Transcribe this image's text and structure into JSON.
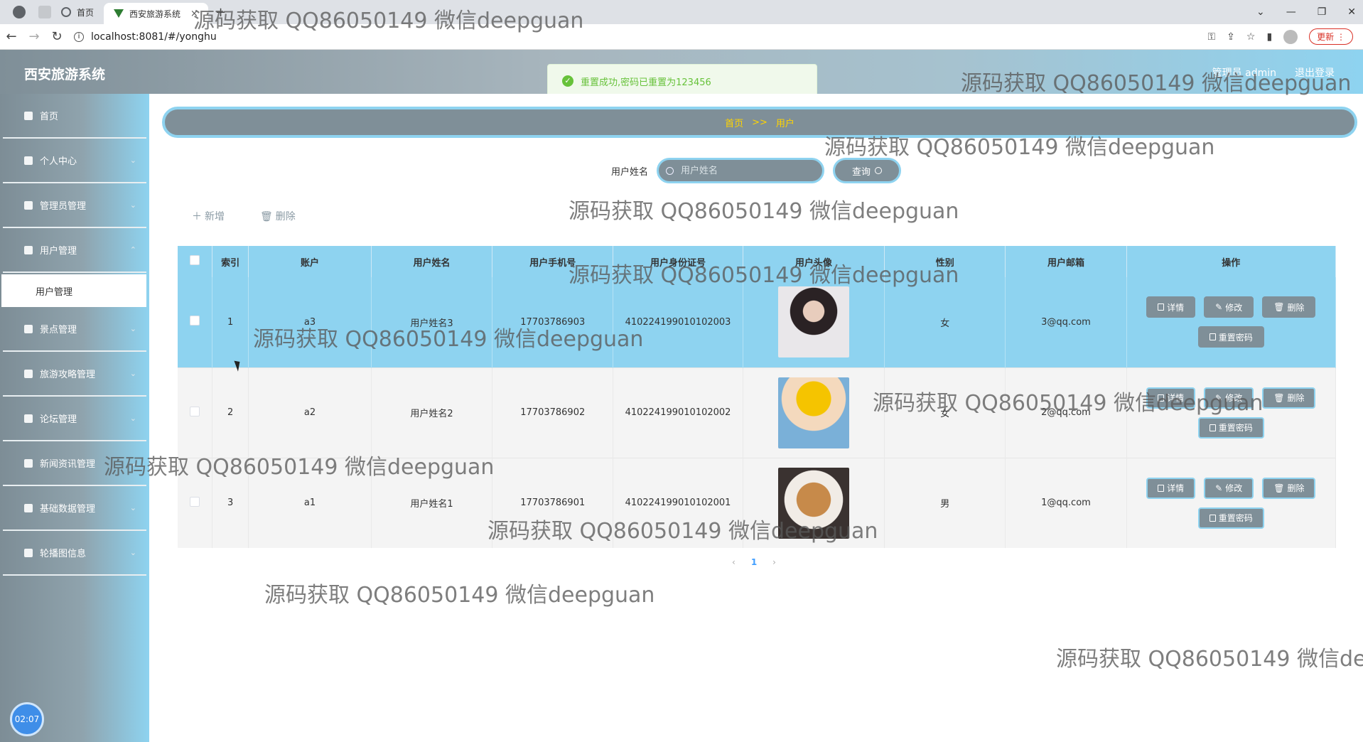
{
  "browser": {
    "tabs": [
      {
        "label": "首页",
        "icon": "globe-icon"
      },
      {
        "label": "西安旅游系统",
        "icon": "vue-logo-icon"
      }
    ],
    "url": "localhost:8081/#/yonghu",
    "update_label": "更新",
    "new_tab": "+",
    "close_tab": "×"
  },
  "app": {
    "title": "西安旅游系统",
    "user_label": "管理员 admin",
    "logout_label": "退出登录"
  },
  "toast": {
    "message": "重置成功,密码已重置为123456",
    "color": "#67c23a"
  },
  "sidebar": {
    "items": [
      {
        "label": "首页",
        "icon": "home-icon",
        "has_arrow": false
      },
      {
        "label": "个人中心",
        "icon": "user-icon",
        "has_arrow": true
      },
      {
        "label": "管理员管理",
        "icon": "grid-icon",
        "has_arrow": true
      },
      {
        "label": "用户管理",
        "icon": "grid-icon",
        "has_arrow": true
      },
      {
        "label": "景点管理",
        "icon": "chat-icon",
        "has_arrow": true
      },
      {
        "label": "旅游攻略管理",
        "icon": "doc-icon",
        "has_arrow": true
      },
      {
        "label": "论坛管理",
        "icon": "user-icon",
        "has_arrow": true
      },
      {
        "label": "新闻资讯管理",
        "icon": "grid-icon",
        "has_arrow": true
      },
      {
        "label": "基础数据管理",
        "icon": "printer-icon",
        "has_arrow": true
      },
      {
        "label": "轮播图信息",
        "icon": "menu-icon",
        "has_arrow": true
      }
    ],
    "submenu_active": "用户管理",
    "clock": "02:07"
  },
  "breadcrumb": {
    "home": "首页",
    "sep": ">>",
    "current": "用户"
  },
  "search": {
    "label": "用户姓名",
    "placeholder": "用户姓名",
    "button": "查询"
  },
  "actions": {
    "add": "新增",
    "delete": "删除"
  },
  "table": {
    "columns": [
      "索引",
      "账户",
      "用户姓名",
      "用户手机号",
      "用户身份证号",
      "用户头像",
      "性别",
      "用户邮箱",
      "操作"
    ],
    "rows": [
      {
        "index": "1",
        "account": "a3",
        "name": "用户姓名3",
        "phone": "17703786903",
        "id_card": "410224199010102003",
        "gender": "女",
        "email": "3@qq.com"
      },
      {
        "index": "2",
        "account": "a2",
        "name": "用户姓名2",
        "phone": "17703786902",
        "id_card": "410224199010102002",
        "gender": "女",
        "email": "2@qq.com"
      },
      {
        "index": "3",
        "account": "a1",
        "name": "用户姓名1",
        "phone": "17703786901",
        "id_card": "410224199010102001",
        "gender": "男",
        "email": "1@qq.com"
      }
    ],
    "ops": {
      "detail": "详情",
      "edit": "修改",
      "delete": "删除",
      "reset": "重置密码"
    }
  },
  "pagination": {
    "prev": "‹",
    "current": "1",
    "next": "›"
  },
  "watermark": "源码获取 QQ86050149 微信deepguan",
  "colors": {
    "accent": "#8ed3f0",
    "primary_dark": "#7f8f98",
    "breadcrumb_text": "#ffd400"
  }
}
